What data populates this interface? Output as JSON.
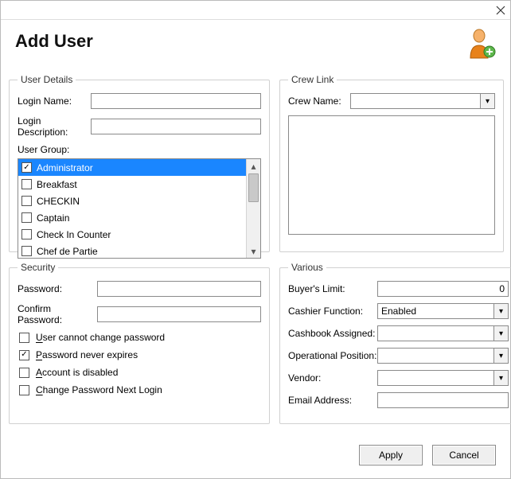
{
  "title": "Add User",
  "groups": {
    "userDetails": "User Details",
    "crewLink": "Crew Link",
    "security": "Security",
    "various": "Various"
  },
  "userDetails": {
    "loginNameLabel": "Login Name:",
    "loginName": "",
    "loginDescLabel": "Login Description:",
    "loginDesc": "",
    "userGroupLabel": "User Group:",
    "groups": [
      {
        "label": "Administrator",
        "checked": true,
        "selected": true
      },
      {
        "label": "Breakfast",
        "checked": false,
        "selected": false
      },
      {
        "label": "CHECKIN",
        "checked": false,
        "selected": false
      },
      {
        "label": "Captain",
        "checked": false,
        "selected": false
      },
      {
        "label": "Check In Counter",
        "checked": false,
        "selected": false
      },
      {
        "label": "Chef de Partie",
        "checked": false,
        "selected": false
      }
    ]
  },
  "crewLink": {
    "crewNameLabel": "Crew Name:",
    "crewName": ""
  },
  "security": {
    "passwordLabel": "Password:",
    "password": "",
    "confirmLabel": "Confirm Password:",
    "confirm": "",
    "opts": [
      {
        "label": "User cannot change password",
        "checked": false,
        "accel": "U"
      },
      {
        "label": "Password never expires",
        "checked": true,
        "accel": "P"
      },
      {
        "label": "Account is disabled",
        "checked": false,
        "accel": "A"
      },
      {
        "label": "Change Password Next Login",
        "checked": false,
        "accel": "C"
      }
    ]
  },
  "various": {
    "buyersLimitLabel": "Buyer's Limit:",
    "buyersLimit": "0",
    "cashierFnLabel": "Cashier Function:",
    "cashierFn": "Enabled",
    "cashbookLabel": "Cashbook Assigned:",
    "cashbook": "",
    "opPosLabel": "Operational Position:",
    "opPos": "",
    "vendorLabel": "Vendor:",
    "vendor": "",
    "emailLabel": "Email Address:",
    "email": ""
  },
  "buttons": {
    "apply": "Apply",
    "cancel": "Cancel"
  }
}
